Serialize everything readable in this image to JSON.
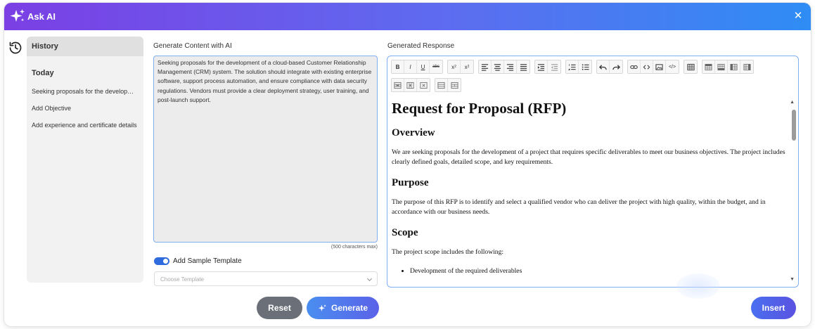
{
  "header": {
    "title": "Ask AI",
    "close_glyph": "✕"
  },
  "sidebar": {
    "history_label": "History",
    "section_today": "Today",
    "items": [
      {
        "label": "Seeking proposals for the development of a cloud-based Customer Relationship Management (CRM) system."
      },
      {
        "label": "Add Objective"
      },
      {
        "label": "Add experience and certificate details"
      }
    ]
  },
  "generate": {
    "label": "Generate Content with AI",
    "prompt_value": "Seeking proposals for the development of a cloud-based Customer Relationship Management (CRM) system. The solution should integrate with existing enterprise software, support process automation, and ensure compliance with data security regulations. Vendors must provide a clear deployment strategy, user training, and post-launch support.",
    "max_chars": "(500 characters max)",
    "sample_toggle_label": "Add Sample Template",
    "sample_toggle_on": true,
    "template_placeholder": "Choose Template",
    "reset_label": "Reset",
    "generate_label": "Generate"
  },
  "response": {
    "label": "Generated Response",
    "toolbar": [
      [
        "bold",
        "italic",
        "underline",
        "strikethrough"
      ],
      [
        "subscript",
        "superscript"
      ],
      [
        "align-left",
        "align-center",
        "align-right",
        "align-justify"
      ],
      [
        "indent",
        "outdent"
      ],
      [
        "ordered-list",
        "unordered-list"
      ],
      [
        "undo",
        "redo"
      ],
      [
        "link",
        "unlink",
        "image",
        "source-code"
      ],
      [
        "table"
      ],
      [
        "insert-row-above",
        "insert-row-below",
        "insert-column-left",
        "insert-column-right"
      ],
      [
        "delete-row",
        "delete-column",
        "delete-table"
      ],
      [
        "merge-cells",
        "split-cells"
      ]
    ],
    "doc": {
      "title": "Request for Proposal (RFP)",
      "overview_heading": "Overview",
      "overview_text": "We are seeking proposals for the development of a project that requires specific deliverables to meet our business objectives. The project includes clearly defined goals, detailed scope, and key requirements.",
      "purpose_heading": "Purpose",
      "purpose_text": "The purpose of this RFP is to identify and select a qualified vendor who can deliver the project with high quality, within the budget, and in accordance with our business needs.",
      "scope_heading": "Scope",
      "scope_text": "The project scope includes the following:",
      "scope_items": [
        "Development of the required deliverables"
      ]
    },
    "insert_label": "Insert"
  },
  "colors": {
    "header_gradient_start": "#7b3fe4",
    "header_gradient_end": "#2f8df5",
    "accent": "#2f6bdc",
    "reset_button": "#6a6f78",
    "input_border": "#7faef2"
  }
}
